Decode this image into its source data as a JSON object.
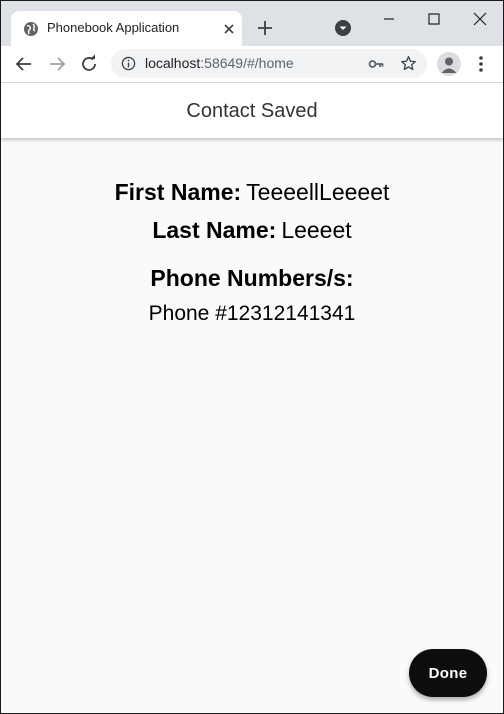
{
  "browser": {
    "tab_title": "Phonebook Application",
    "url_host": "localhost",
    "url_rest": ":58649/#/home"
  },
  "app": {
    "title": "Contact Saved",
    "first_name_label": "First Name:",
    "first_name_value": "TeeeellLeeeet",
    "last_name_label": "Last Name:",
    "last_name_value": "Leeeet",
    "phones_label": "Phone Numbers/s:",
    "phones": [
      "Phone #12312141341"
    ],
    "done_label": "Done"
  },
  "colors": {
    "tabstrip": "#dee1e6",
    "app_background": "#fafafa",
    "done_button": "#0d0d0d"
  },
  "icons": [
    "globe-icon",
    "close-icon",
    "plus-icon",
    "dropdown-icon",
    "minimize-icon",
    "maximize-icon",
    "window-close-icon",
    "back-icon",
    "forward-icon",
    "reload-icon",
    "info-icon",
    "key-icon",
    "star-icon",
    "profile-icon",
    "more-icon"
  ]
}
